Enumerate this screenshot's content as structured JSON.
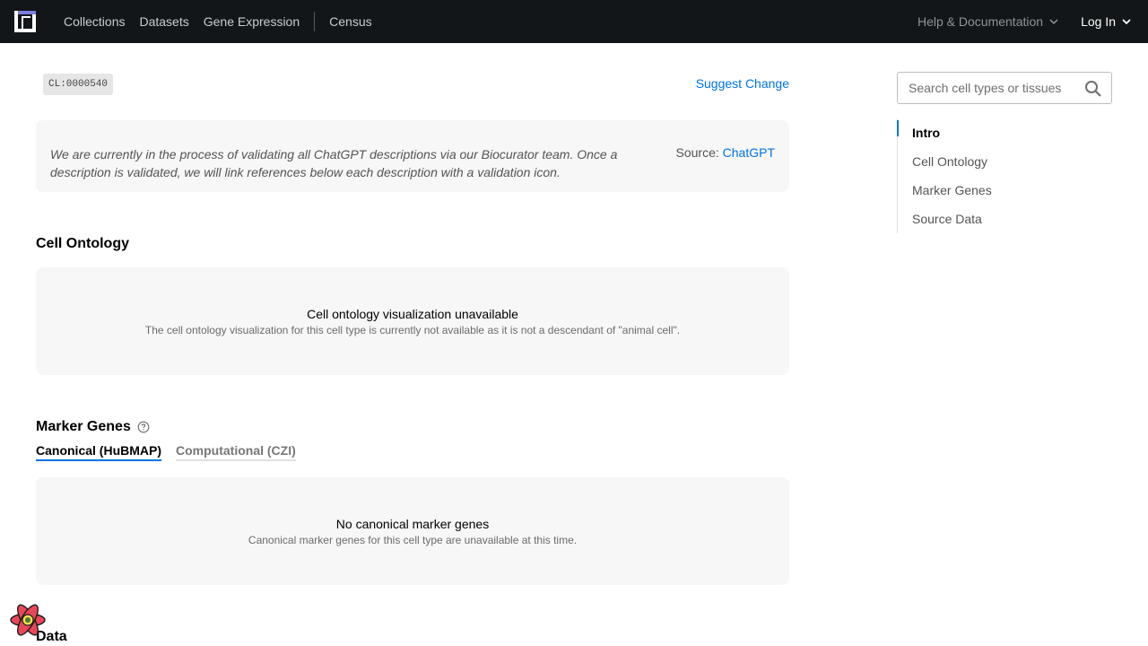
{
  "nav": {
    "links": [
      "Collections",
      "Datasets",
      "Gene Expression",
      "Census"
    ],
    "help_label": "Help & Documentation",
    "login_label": "Log In"
  },
  "header": {
    "ontology_id": "CL:0000540",
    "suggest_change": "Suggest Change"
  },
  "description": {
    "text": "We are currently in the process of validating all ChatGPT descriptions via our Biocurator team. Once a description is validated, we will link references below each description with a validation icon.",
    "source_prefix": "Source:",
    "source_link": "ChatGPT"
  },
  "cell_ontology": {
    "heading": "Cell Ontology",
    "title": "Cell ontology visualization unavailable",
    "subtitle": "The cell ontology visualization for this cell type is currently not available as it is not a descendant of \"animal cell\"."
  },
  "marker_genes": {
    "heading": "Marker Genes",
    "tabs": [
      "Canonical (HuBMAP)",
      "Computational (CZI)"
    ],
    "title": "No canonical marker genes",
    "subtitle": "Canonical marker genes for this cell type are unavailable at this time."
  },
  "data_heading": "Data",
  "sidebar": {
    "search_placeholder": "Search cell types or tissues",
    "toc": [
      "Intro",
      "Cell Ontology",
      "Marker Genes",
      "Source Data"
    ]
  },
  "colors": {
    "accent": "#0073e6",
    "nav_bg": "#121619",
    "panel_bg": "#f7f7f7"
  }
}
